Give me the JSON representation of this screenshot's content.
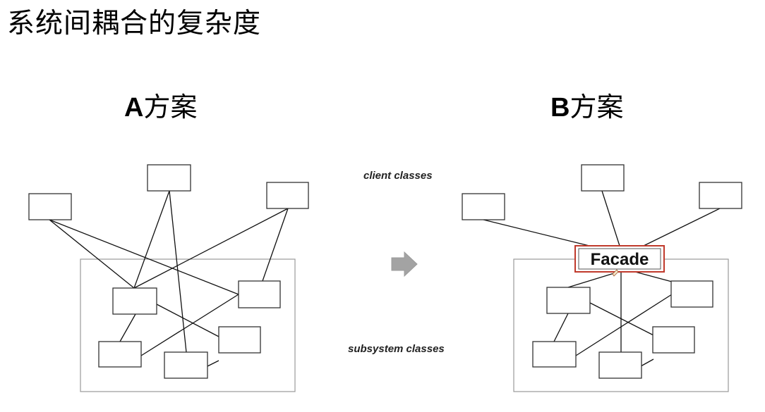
{
  "page": {
    "title": "系统间耦合的复杂度"
  },
  "schemes": {
    "a": {
      "letter": "A",
      "suffix": "方案"
    },
    "b": {
      "letter": "B",
      "suffix": "方案"
    }
  },
  "captions": {
    "client": "client classes",
    "subsystem": "subsystem classes"
  },
  "facade": {
    "label": "Facade"
  },
  "colors": {
    "line": "#111111",
    "box_border": "#333333",
    "container_border": "#9a9a9a",
    "arrow": "#a3a3a3",
    "facade_border": "#c0392b"
  },
  "icons": {
    "transition_arrow": "arrow-right-icon"
  }
}
